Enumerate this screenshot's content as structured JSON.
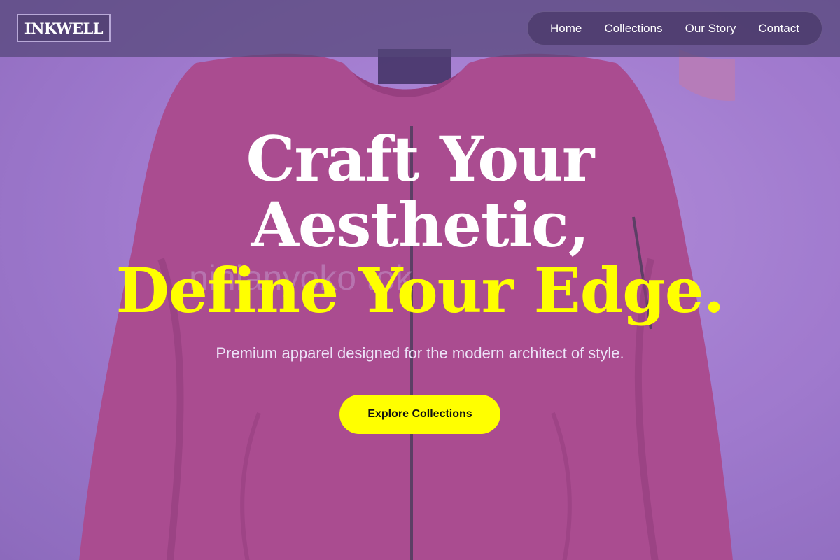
{
  "brand": {
    "logo_text": "INKWELL"
  },
  "nav": {
    "items": [
      {
        "label": "Home"
      },
      {
        "label": "Collections"
      },
      {
        "label": "Our Story"
      },
      {
        "label": "Contact"
      }
    ]
  },
  "hero": {
    "title_line_1": "Craft Your",
    "title_line_2": "Aesthetic,",
    "title_line_3": "Define Your Edge.",
    "subtitle": "Premium apparel designed for the modern architect of style.",
    "cta_label": "Explore Collections",
    "background_watermark": "ninianyoko tok"
  },
  "colors": {
    "accent": "#ffff00",
    "header_bg": "#554678",
    "backdrop": "#a883d6",
    "jacket": "#b04d8e"
  }
}
